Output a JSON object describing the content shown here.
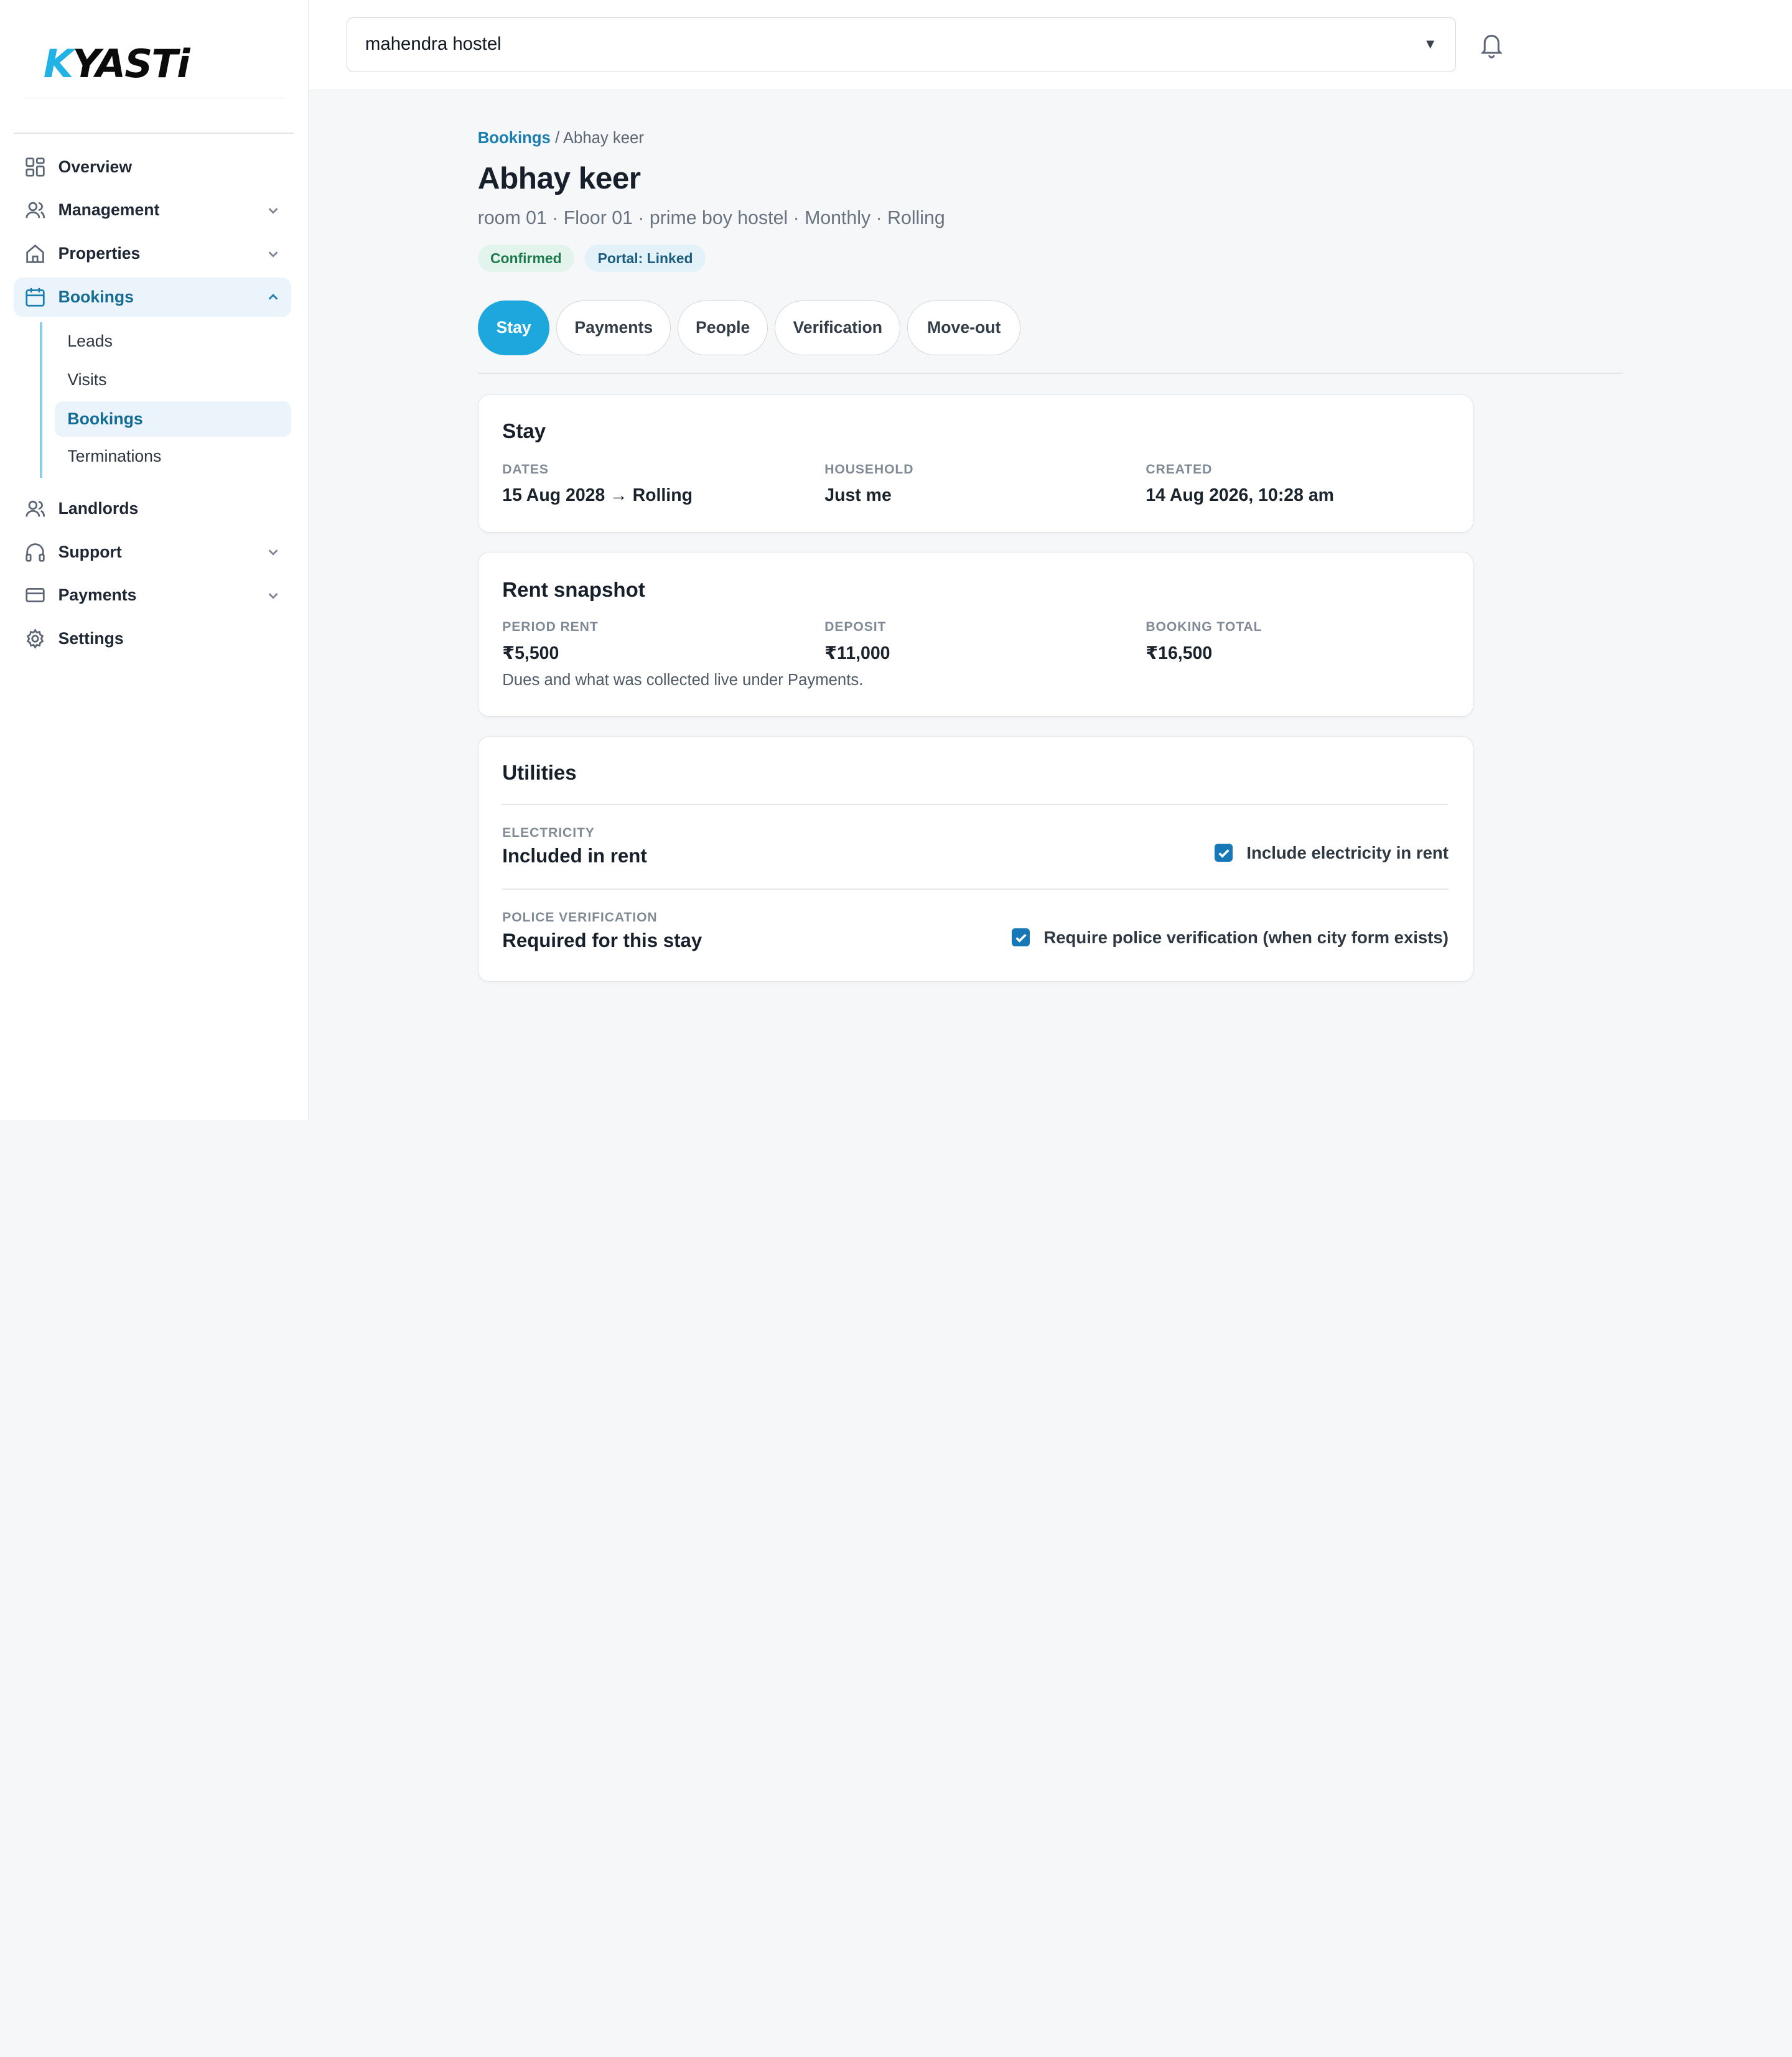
{
  "brand": {
    "logo_text": "KYASTi"
  },
  "sidebar": {
    "items": [
      {
        "label": "Overview",
        "icon": "grid-icon"
      },
      {
        "label": "Management",
        "icon": "users-icon"
      },
      {
        "label": "Properties",
        "icon": "home-icon"
      },
      {
        "label": "Bookings",
        "icon": "calendar-icon"
      },
      {
        "label": "Landlords",
        "icon": "users-icon"
      },
      {
        "label": "Support",
        "icon": "headphones-icon"
      },
      {
        "label": "Payments",
        "icon": "credit-card-icon"
      },
      {
        "label": "Settings",
        "icon": "gear-icon"
      }
    ],
    "bookings_sub": [
      "Leads",
      "Visits",
      "Bookings",
      "Terminations"
    ]
  },
  "topbar": {
    "property": "mahendra hostel"
  },
  "breadcrumb": {
    "root": "Bookings",
    "separator": "/",
    "current": "Abhay keer"
  },
  "booking": {
    "name": "Abhay keer",
    "subtitle": "room 01 · Floor 01 · prime boy hostel · Monthly · Rolling",
    "badges": {
      "status": "Confirmed",
      "portal": "Portal: Linked"
    }
  },
  "tabs": [
    "Stay",
    "Payments",
    "People",
    "Verification",
    "Move-out"
  ],
  "stay": {
    "title": "Stay",
    "dates_label": "DATES",
    "dates_value": "15 Aug 2028 → Rolling",
    "household_label": "HOUSEHOLD",
    "household_value": "Just me",
    "created_label": "CREATED",
    "created_value": "14 Aug 2026, 10:28 am"
  },
  "rent": {
    "title": "Rent snapshot",
    "period_label": "PERIOD RENT",
    "period_value": "₹5,500",
    "deposit_label": "DEPOSIT",
    "deposit_value": "₹11,000",
    "total_label": "BOOKING TOTAL",
    "total_value": "₹16,500",
    "note": "Dues and what was collected live under Payments."
  },
  "utilities": {
    "title": "Utilities",
    "electricity_label": "ELECTRICITY",
    "electricity_value": "Included in rent",
    "electricity_check": "Include electricity in rent",
    "police_label": "POLICE VERIFICATION",
    "police_value": "Required for this stay",
    "police_check": "Require police verification (when city form exists)"
  },
  "colors": {
    "accent": "#1ea7dd",
    "active_nav": "#146c95",
    "checkbox": "#1778b8"
  }
}
